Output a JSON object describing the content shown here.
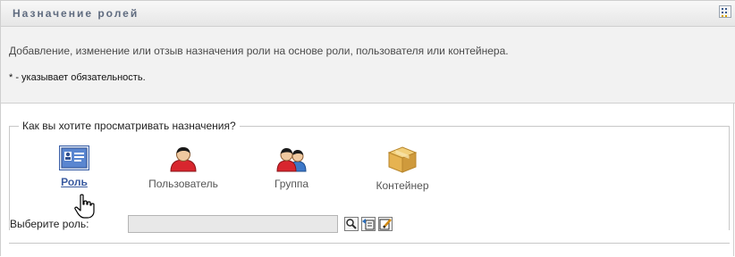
{
  "header": {
    "title": "Назначение ролей",
    "menu_icon": "grid-menu-icon"
  },
  "info": {
    "description": "Добавление, изменение или отзыв назначения роли на основе роли, пользователя или контейнера.",
    "required_note": "* - указывает обязательность."
  },
  "view": {
    "legend": "Как вы хотите просматривать назначения?",
    "options": [
      {
        "label": "Роль",
        "icon": "role-card-icon",
        "selected": true
      },
      {
        "label": "Пользователь",
        "icon": "user-icon",
        "selected": false
      },
      {
        "label": "Группа",
        "icon": "group-icon",
        "selected": false
      },
      {
        "label": "Контейнер",
        "icon": "container-box-icon",
        "selected": false
      }
    ]
  },
  "select": {
    "label": "Выберите роль:",
    "value": "",
    "buttons": [
      "search-icon",
      "history-icon",
      "edit-icon"
    ]
  },
  "colors": {
    "accent": "#3a5ba0",
    "header_text": "#5f6b7f",
    "info_bg": "#f2f2f2"
  }
}
